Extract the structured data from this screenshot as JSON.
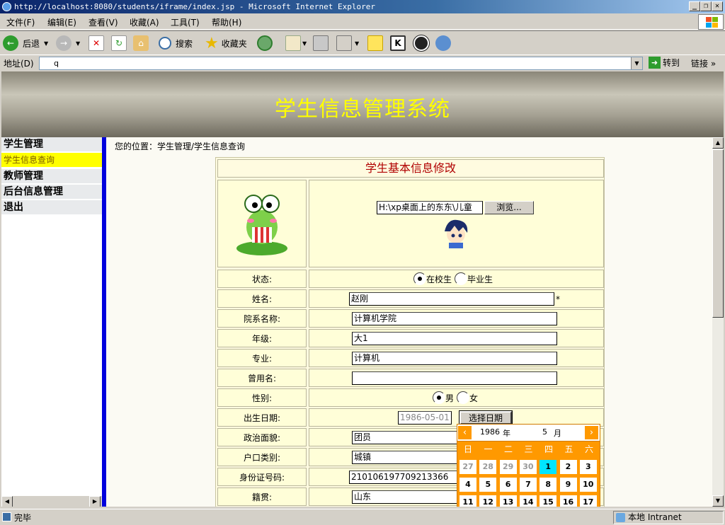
{
  "window": {
    "title": "http://localhost:8080/students/iframe/index.jsp - Microsoft Internet Explorer"
  },
  "menu": [
    "文件(F)",
    "编辑(E)",
    "查看(V)",
    "收藏(A)",
    "工具(T)",
    "帮助(H)"
  ],
  "toolbar": {
    "back": "后退",
    "search": "搜索",
    "favorites": "收藏夹"
  },
  "address": {
    "label": "地址(D)",
    "value": "q",
    "go": "转到",
    "links": "链接"
  },
  "banner": {
    "title": "学生信息管理系统"
  },
  "sidebar": {
    "items": [
      {
        "label": "学生管理"
      },
      {
        "label": "学生信息查询"
      },
      {
        "label": "教师管理"
      },
      {
        "label": "后台信息管理"
      },
      {
        "label": "退出"
      }
    ]
  },
  "breadcrumb": "您的位置：学生管理/学生信息查询",
  "form": {
    "title": "学生基本信息修改",
    "file_value": "H:\\xp桌面上的东东\\儿童",
    "browse": "浏览...",
    "status_label": "状态:",
    "status_options": [
      "在校生",
      "毕业生"
    ],
    "name_label": "姓名:",
    "name_value": "赵刚",
    "required": "*",
    "dept_label": "院系名称:",
    "dept_value": "计算机学院",
    "grade_label": "年级:",
    "grade_value": "大1",
    "major_label": "专业:",
    "major_value": "计算机",
    "alias_label": "曾用名:",
    "alias_value": "",
    "gender_label": "性别:",
    "gender_options": [
      "男",
      "女"
    ],
    "birth_label": "出生日期:",
    "birth_value": "1986-05-01",
    "pick_date": "选择日期",
    "politics_label": "政治面貌:",
    "politics_value": "团员",
    "hukou_label": "户口类别:",
    "hukou_value": "城镇",
    "id_label": "身份证号码:",
    "id_value": "210106197709213366",
    "origin_label": "籍贯:",
    "origin_value": "山东"
  },
  "calendar": {
    "year": "1986",
    "year_unit": "年",
    "month": "5",
    "month_unit": "月",
    "weekdays": [
      "日",
      "一",
      "二",
      "三",
      "四",
      "五",
      "六"
    ],
    "rows": [
      [
        "27",
        "28",
        "29",
        "30",
        "1",
        "2",
        "3"
      ],
      [
        "4",
        "5",
        "6",
        "7",
        "8",
        "9",
        "10"
      ],
      [
        "11",
        "12",
        "13",
        "14",
        "15",
        "16",
        "17"
      ]
    ],
    "selected": "1"
  },
  "status": {
    "text": "完毕",
    "zone": "本地 Intranet"
  }
}
